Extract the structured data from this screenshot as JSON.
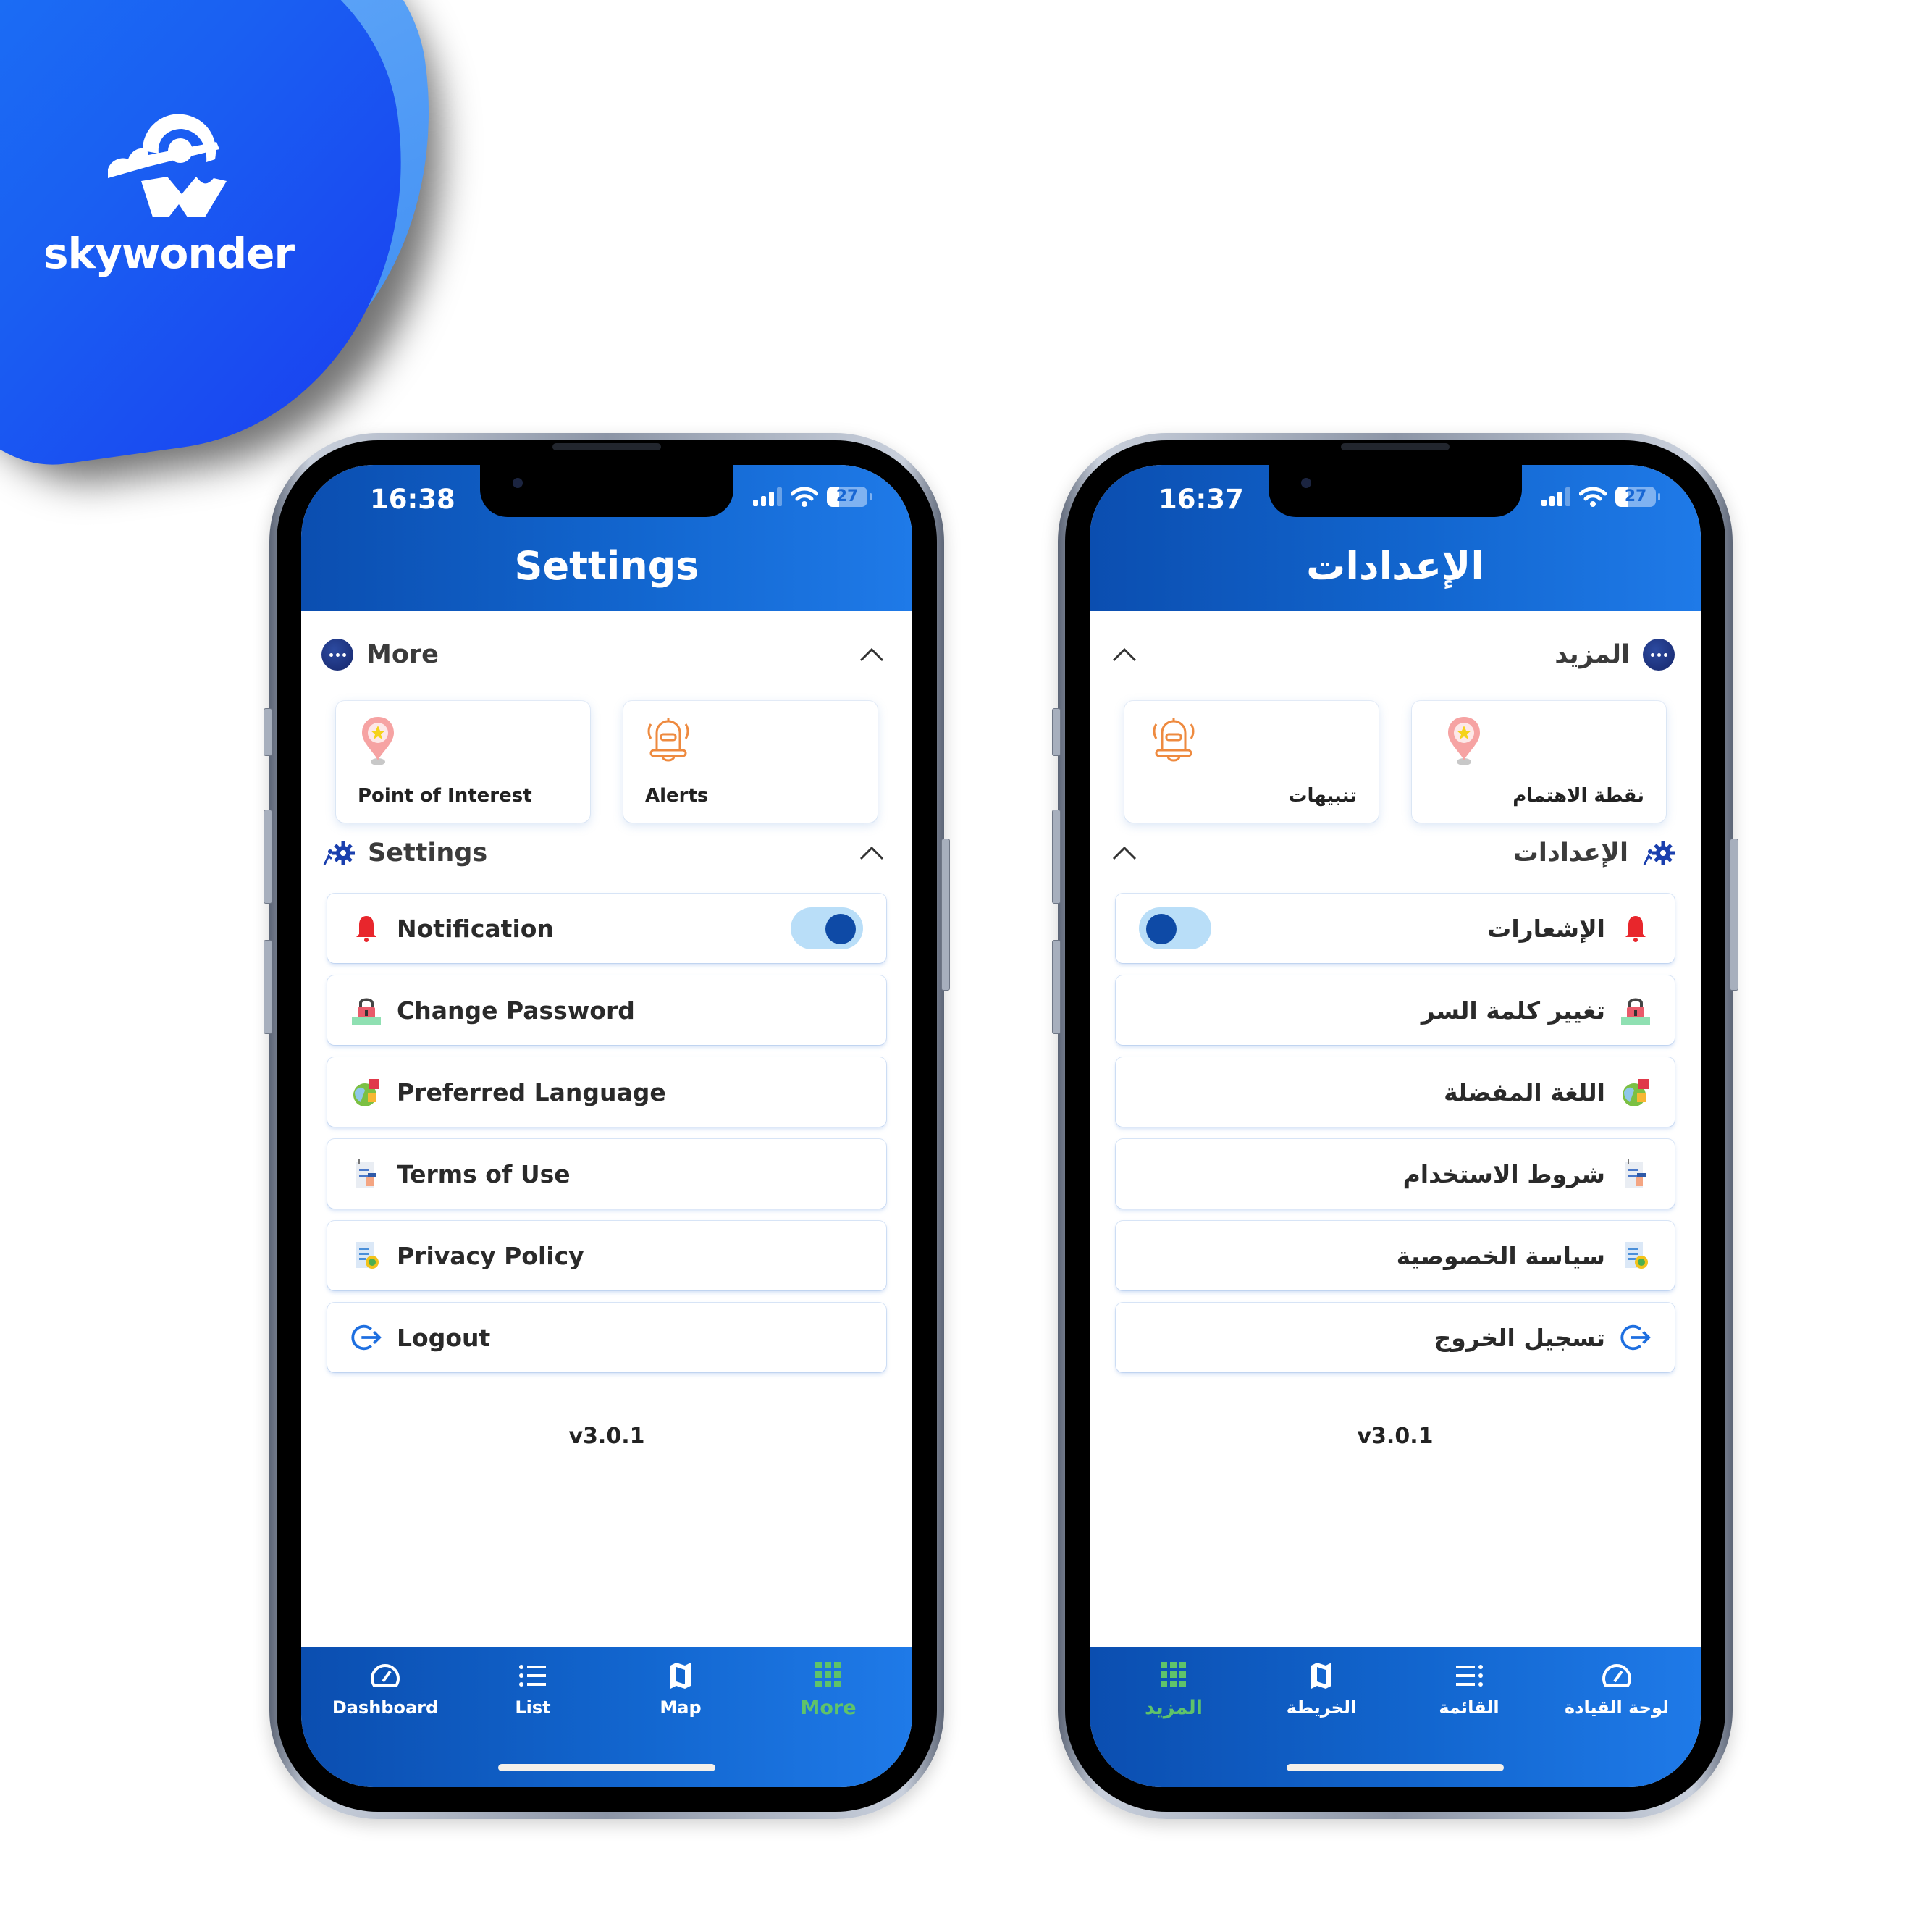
{
  "brand": {
    "name": "skywonder",
    "colors": {
      "blob_primary": "#1a5ff2",
      "blob_accent": "#5aa2f7"
    }
  },
  "theme": {
    "header_blue": "#1266cf",
    "active_tab_color": "#5fc36a",
    "toggle_track": "#b9def8",
    "toggle_knob": "#0e4aa6",
    "notification_icon": "#e8262c",
    "logout_icon": "#1e6fe0"
  },
  "phones": [
    {
      "direction": "ltr",
      "status": {
        "time": "16:38",
        "battery": "27",
        "icons": [
          "signal-icon",
          "wifi-icon",
          "battery-icon"
        ]
      },
      "title": "Settings",
      "more_section": {
        "title": "More",
        "icon": "more-dots-icon",
        "expanded": true,
        "tiles": [
          {
            "label": "Point of Interest",
            "icon": "map-pin-star-icon"
          },
          {
            "label": "Alerts",
            "icon": "alert-bell-icon"
          }
        ]
      },
      "settings_section": {
        "title": "Settings",
        "icon": "gears-icon",
        "expanded": true,
        "items": [
          {
            "label": "Notification",
            "icon": "bell-icon",
            "toggle": true,
            "toggle_on": true
          },
          {
            "label": "Change Password",
            "icon": "lock-icon"
          },
          {
            "label": "Preferred Language",
            "icon": "language-icon"
          },
          {
            "label": "Terms of Use",
            "icon": "document-icon"
          },
          {
            "label": "Privacy Policy",
            "icon": "privacy-document-icon"
          },
          {
            "label": "Logout",
            "icon": "logout-icon"
          }
        ]
      },
      "version": "v3.0.1",
      "tabs": [
        {
          "label": "Dashboard",
          "icon": "speedometer-icon",
          "active": false
        },
        {
          "label": "List",
          "icon": "list-icon",
          "active": false
        },
        {
          "label": "Map",
          "icon": "map-icon",
          "active": false
        },
        {
          "label": "More",
          "icon": "grid-icon",
          "active": true
        }
      ]
    },
    {
      "direction": "rtl",
      "status": {
        "time": "16:37",
        "battery": "27",
        "icons": [
          "signal-icon",
          "wifi-icon",
          "battery-icon"
        ]
      },
      "title": "الإعدادات",
      "more_section": {
        "title": "المزيد",
        "icon": "more-dots-icon",
        "expanded": true,
        "tiles": [
          {
            "label": "نقطة الاهتمام",
            "icon": "map-pin-star-icon"
          },
          {
            "label": "تنبيهات",
            "icon": "alert-bell-icon"
          }
        ]
      },
      "settings_section": {
        "title": "الإعدادات",
        "icon": "gears-icon",
        "expanded": true,
        "items": [
          {
            "label": "الإشعارات",
            "icon": "bell-icon",
            "toggle": true,
            "toggle_on": true
          },
          {
            "label": "تغيير كلمة السر",
            "icon": "lock-icon"
          },
          {
            "label": "اللغة المفضلة",
            "icon": "language-icon"
          },
          {
            "label": "شروط الاستخدام",
            "icon": "document-icon"
          },
          {
            "label": "سياسة الخصوصية",
            "icon": "privacy-document-icon"
          },
          {
            "label": "تسجيل الخروج",
            "icon": "logout-icon"
          }
        ]
      },
      "version": "v3.0.1",
      "tabs": [
        {
          "label": "لوحة القيادة",
          "icon": "speedometer-icon",
          "active": false
        },
        {
          "label": "القائمة",
          "icon": "list-icon",
          "active": false
        },
        {
          "label": "الخريطة",
          "icon": "map-icon",
          "active": false
        },
        {
          "label": "المزيد",
          "icon": "grid-icon",
          "active": true
        }
      ]
    }
  ]
}
